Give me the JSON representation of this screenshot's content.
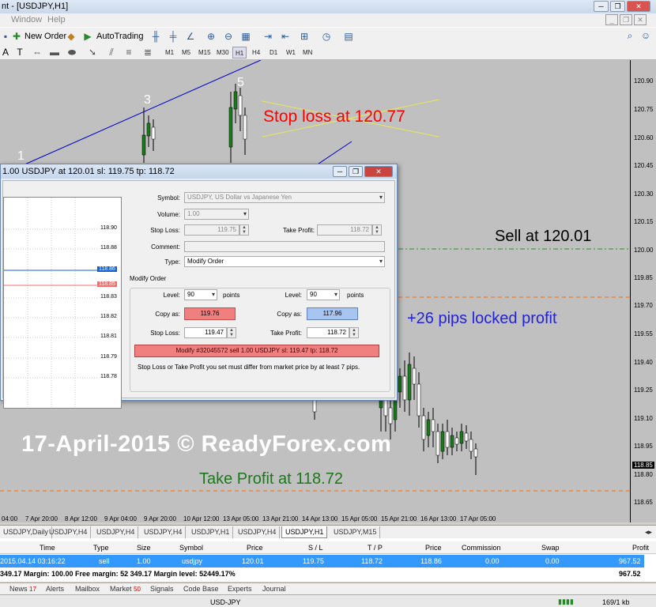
{
  "window": {
    "title": "nt - [USDJPY,H1]"
  },
  "menu": {
    "items": [
      "Window",
      "Help"
    ]
  },
  "toolbar": {
    "new_order": "New Order",
    "autotrading": "AutoTrading",
    "timeframes": [
      "M1",
      "M5",
      "M15",
      "M30",
      "H1",
      "H4",
      "D1",
      "W1",
      "MN"
    ],
    "active_timeframe": "H1"
  },
  "chart": {
    "price_labels": [
      "120.90",
      "120.75",
      "120.60",
      "120.45",
      "120.30",
      "120.15",
      "120.00",
      "119.85",
      "119.70",
      "119.55",
      "119.40",
      "119.25",
      "119.10",
      "118.95",
      "118.80",
      "118.65"
    ],
    "current_price": "118.85",
    "time_labels": [
      "04:00",
      "7 Apr 20:00",
      "8 Apr 12:00",
      "9 Apr 04:00",
      "9 Apr 20:00",
      "10 Apr 12:00",
      "13 Apr 05:00",
      "13 Apr 21:00",
      "14 Apr 13:00",
      "15 Apr 05:00",
      "15 Apr 21:00",
      "16 Apr 13:00",
      "17 Apr 05:00"
    ],
    "wave_labels": [
      "1",
      "3",
      "5"
    ],
    "annotation_stoploss": "Stop loss at 120.77",
    "annotation_sell": "Sell at 120.01",
    "annotation_pips": "+26 pips locked profit",
    "annotation_tp": "Take Profit at 118.72",
    "watermark": "17-April-2015 © ReadyForex.com",
    "colors": {
      "stoploss": "#ff0000",
      "sell": "#000000",
      "pips": "#2222dd",
      "tp": "#1a7a1a",
      "trendline": "#0000cc",
      "sell_line": "#2e8b2e",
      "tp_line": "#ff6a00"
    }
  },
  "dialog": {
    "title": "1.00 USDJPY at 120.01 sl: 119.75 tp: 118.72",
    "mini_prices": [
      "118.90",
      "118.88",
      "118.86",
      "118.85",
      "118.83",
      "118.82",
      "118.81",
      "118.79",
      "118.78"
    ],
    "mini_bid": "118.86",
    "mini_ask": "118.85",
    "symbol_label": "Symbol:",
    "symbol_value": "USDJPY, US Dollar vs Japanese Yen",
    "volume_label": "Volume:",
    "volume_value": "1.00",
    "stoploss_label": "Stop Loss:",
    "stoploss_value": "119.75",
    "takeprofit_label": "Take Profit:",
    "takeprofit_value": "118.72",
    "comment_label": "Comment:",
    "comment_value": "",
    "type_label": "Type:",
    "type_value": "Modify Order",
    "group_title": "Modify Order",
    "level_label": "Level:",
    "level_left": "90",
    "level_right": "90",
    "points": "points",
    "copyas_label": "Copy as:",
    "copyas_left": "119.76",
    "copyas_right": "117.96",
    "sl_label": "Stop Loss:",
    "sl_value": "119.47",
    "tp_label": "Take Profit:",
    "tp_value": "118.72",
    "modify_button": "Modify #32045572 sell 1.00 USDJPY sl: 119.47 tp: 118.72",
    "note": "Stop Loss or Take Profit you set must differ from market price by at least 7 pips."
  },
  "chart_tabs": [
    "USDJPY,Daily",
    "USDJPY,H4",
    "USDJPY,H4",
    "USDJPY,H4",
    "USDJPY,H1",
    "USDJPY,H4",
    "USDJPY,H1",
    "USDJPY,M15"
  ],
  "active_chart_tab": 6,
  "terminal": {
    "headers": [
      "Time",
      "Type",
      "Size",
      "Symbol",
      "Price",
      "S / L",
      "T / P",
      "Price",
      "Commission",
      "Swap",
      "Profit"
    ],
    "order": {
      "time": "2015.04.14 03:16:22",
      "type": "sell",
      "size": "1.00",
      "symbol": "usdjpy",
      "price": "120.01",
      "sl": "119.75",
      "tp": "118.72",
      "cur_price": "118.86",
      "commission": "0.00",
      "swap": "0.00",
      "profit": "967.52"
    },
    "balance_text": "349.17  Margin: 100.00  Free margin: 52 349.17  Margin level: 52449.17%",
    "balance_profit": "967.52"
  },
  "bottom_tabs": {
    "news": "News",
    "news_count": "17",
    "alerts": "Alerts",
    "mailbox": "Mailbox",
    "market": "Market",
    "market_count": "50",
    "signals": "Signals",
    "codebase": "Code Base",
    "experts": "Experts",
    "journal": "Journal"
  },
  "status": {
    "symbol": "USD-JPY",
    "traffic": "169/1 kb"
  }
}
